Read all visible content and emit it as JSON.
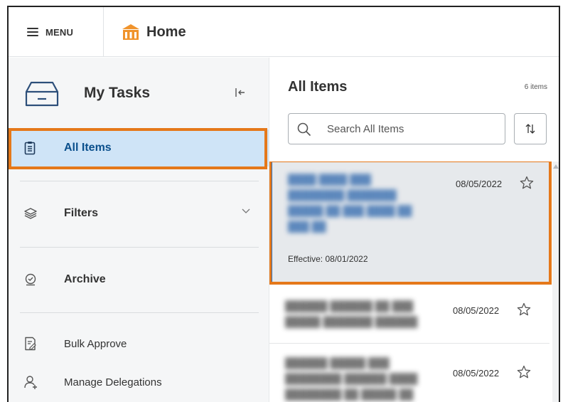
{
  "header": {
    "menu_label": "MENU",
    "home_label": "Home",
    "home_icon": "building-icon"
  },
  "sidebar": {
    "title": "My Tasks",
    "items": [
      {
        "label": "All Items",
        "icon": "clipboard-icon",
        "selected": true
      },
      {
        "label": "Filters",
        "icon": "layers-icon"
      },
      {
        "label": "Archive",
        "icon": "check-circle-icon"
      },
      {
        "label": "Bulk Approve",
        "icon": "edit-document-icon"
      },
      {
        "label": "Manage Delegations",
        "icon": "person-add-icon"
      }
    ]
  },
  "main": {
    "title": "All Items",
    "count": "6 items",
    "search_placeholder": "Search All Items",
    "cards": [
      {
        "date": "08/05/2022",
        "effective": "Effective: 08/01/2022"
      },
      {
        "date": "08/05/2022"
      },
      {
        "date": "08/05/2022"
      }
    ]
  },
  "colors": {
    "accent_highlight": "#e5781a",
    "selected_bg": "#cfe4f7",
    "selected_text": "#0a4f8c",
    "card_selected_border": "#2d6db5",
    "home_icon": "#f0932b"
  }
}
